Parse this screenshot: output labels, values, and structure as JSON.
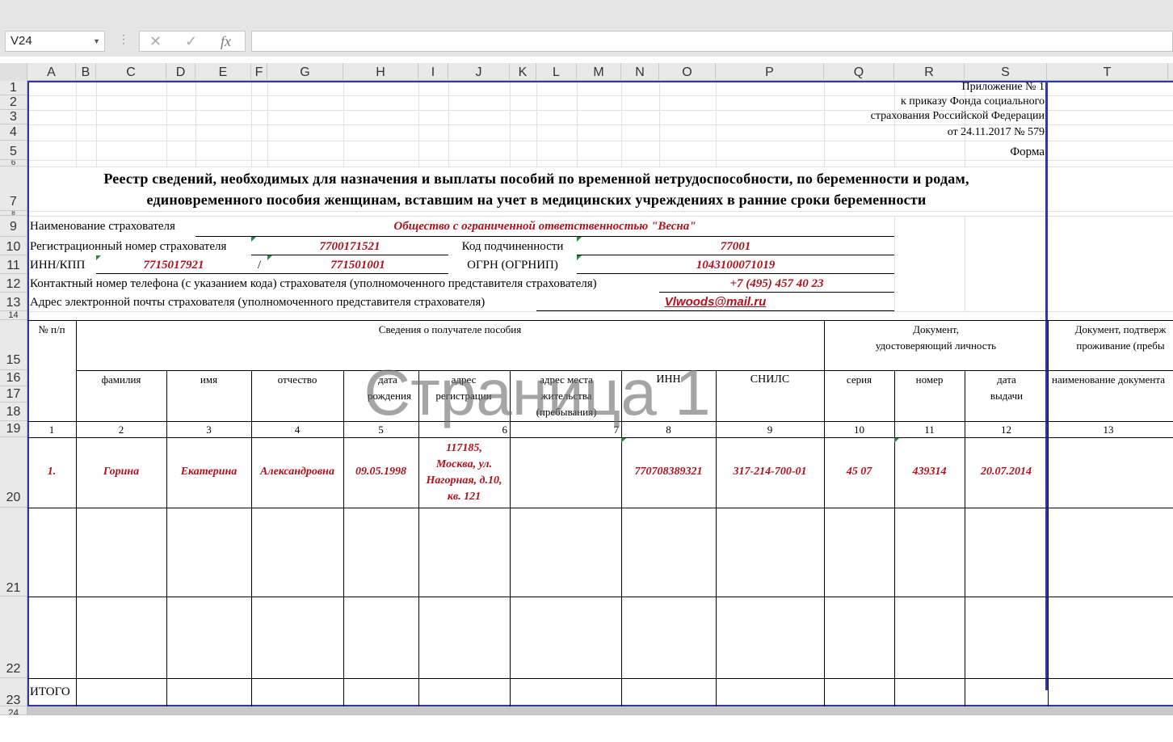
{
  "formula_bar": {
    "name_box": "V24",
    "formula": ""
  },
  "columns": [
    "A",
    "B",
    "C",
    "D",
    "E",
    "F",
    "G",
    "H",
    "I",
    "J",
    "K",
    "L",
    "M",
    "N",
    "O",
    "P",
    "Q",
    "R",
    "S",
    "T"
  ],
  "rows": [
    "1",
    "2",
    "3",
    "4",
    "5",
    "6",
    "7",
    "8",
    "9",
    "10",
    "11",
    "12",
    "13",
    "14",
    "15",
    "16",
    "17",
    "18",
    "19",
    "20",
    "21",
    "22",
    "23",
    "24"
  ],
  "header": {
    "appendix": "Приложение № 1",
    "order": "к приказу Фонда социального",
    "fund": "страхования Российской Федерации",
    "date": "от 24.11.2017 № 579",
    "form": "Форма"
  },
  "title": {
    "line1": "Реестр сведений, необходимых для назначения и выплаты пособий по временной нетрудоспособности, по беременности и родам,",
    "line2": "единовременного пособия женщинам, вставшим на учет в медицинских учреждениях в ранние сроки беременности"
  },
  "insurer": {
    "name_label": "Наименование страхователя",
    "name_value": "Общество с ограниченной ответственностью \"Весна\"",
    "reg_label": "Регистрационный номер страхователя",
    "reg_value": "7700171521",
    "sub_label": "Код подчиненности",
    "sub_value": "77001",
    "innkpp_label": "ИНН/КПП",
    "inn_value": "7715017921",
    "slash": "/",
    "kpp_value": "771501001",
    "ogrn_label": "ОГРН (ОГРНИП)",
    "ogrn_value": "1043100071019",
    "phone_label": "Контактный номер телефона (с указанием кода) страхователя (уполномоченного представителя страхователя)",
    "phone_value": "+7 (495) 457 40 23",
    "email_label": "Адрес электронной почты страхователя (уполномоченного представителя страхователя)",
    "email_value": "Vlwoods@mail.ru"
  },
  "table": {
    "num_header": "№ п/п",
    "recipient_header": "Сведения о получателе пособия",
    "doc_header_1": "Документ,",
    "doc_header_2": "удостоверяющий личность",
    "residence_header_1": "Документ, подтверж",
    "residence_header_2": "проживание (пребы",
    "columns": [
      "фамилия",
      "имя",
      "отчество",
      "дата рождения",
      "адрес регистрации",
      "адрес места жительства (пребывания)",
      "ИНН",
      "СНИЛС",
      "серия",
      "номер",
      "дата выдачи",
      "наименование документа"
    ],
    "numbers": [
      "1",
      "2",
      "3",
      "4",
      "5",
      "6",
      "7",
      "8",
      "9",
      "10",
      "11",
      "12",
      "13"
    ],
    "rows": [
      {
        "num": "1.",
        "surname": "Горина",
        "name": "Екатерина",
        "patronymic": "Александровна",
        "birth_date": "09.05.1998",
        "address_lines": [
          "117185,",
          "Москва, ул.",
          "Нагорная, д.10,",
          "кв. 121"
        ],
        "residence": "",
        "inn": "770708389321",
        "snils": "317-214-700-01",
        "series": "45 07",
        "number": "439314",
        "issue_date": "20.07.2014",
        "doc_name": ""
      }
    ],
    "total_label": "ИТОГО"
  },
  "watermark": "Страница 1"
}
